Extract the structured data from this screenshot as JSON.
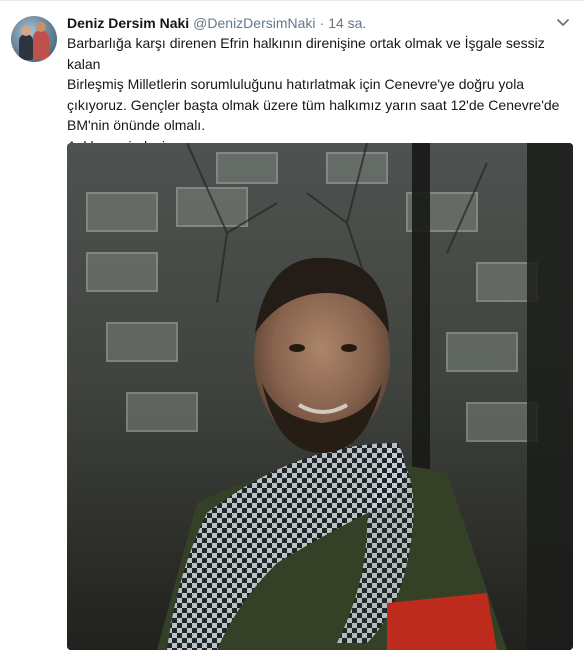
{
  "tweet": {
    "author_name": "Deniz Dersim Naki",
    "handle": "@DenizDersimNaki",
    "separator": "·",
    "time": "14 sa.",
    "text_lines": [
      "Barbarlığa karşı direnen Efrin halkının direnişine ortak olmak ve İşgale sessiz kalan",
      "Birleşmiş Milletlerin sorumluluğunu hatırlatmak için Cenevre'ye doğru yola",
      "çıkıyoruz. Gençler başta olmak üzere tüm halkımız yarın saat 12'de Cenevre'de",
      "BM'nin önünde olmalı.",
      "Açlık grevindeyiz."
    ],
    "menu_icon": "chevron-down-icon",
    "photo_icon": "photo"
  },
  "colors": {
    "name": "#14171a",
    "secondary": "#657786",
    "border": "#e6ecf0"
  }
}
